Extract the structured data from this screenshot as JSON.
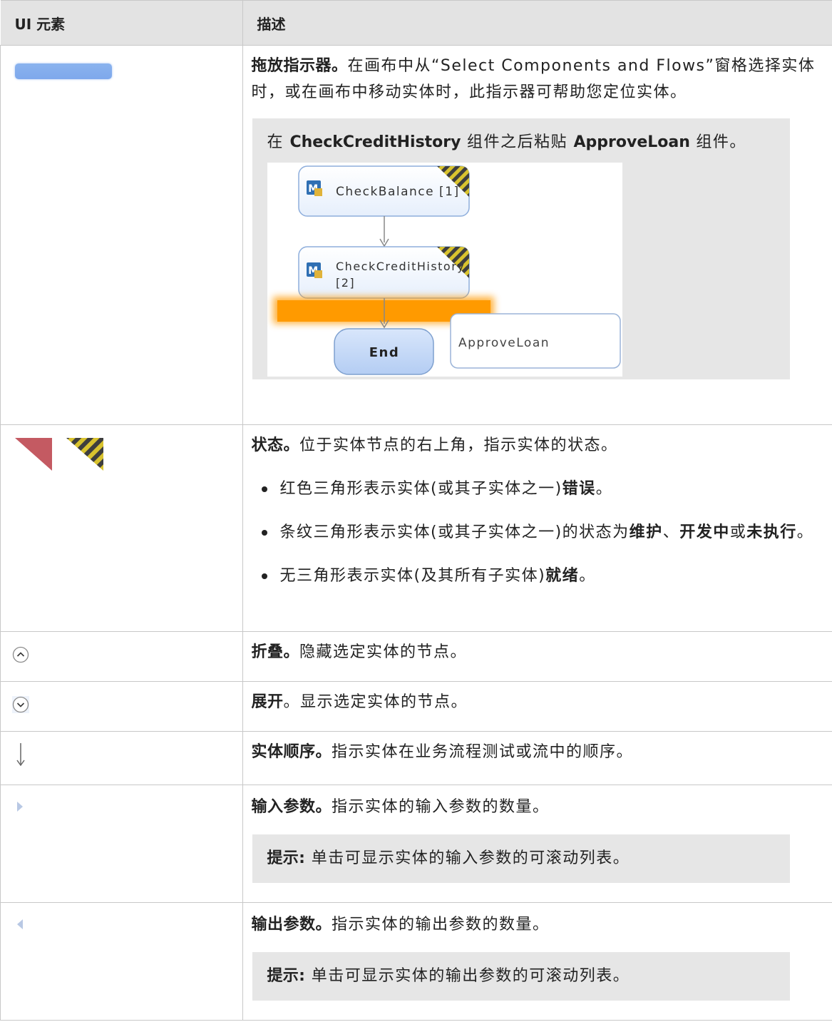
{
  "header": {
    "col1": "UI 元素",
    "col2": "描述"
  },
  "rows": {
    "drop": {
      "title": "拖放指示器。",
      "text": "在画布中从“Select Components and Flows”窗格选择实体时，或在画布中移动实体时，此指示器可帮助您定位实体。",
      "note": {
        "pre": "在 ",
        "comp1": "CheckCreditHistory",
        "mid": " 组件之后粘贴 ",
        "comp2": "ApproveLoan",
        "post": " 组件。"
      },
      "diagram": {
        "node1": "CheckBalance [1]",
        "node2_line1": "CheckCreditHistory",
        "node2_line2": "[2]",
        "end": "End",
        "dragged": "ApproveLoan"
      }
    },
    "status": {
      "title": "状态。",
      "text": "位于实体节点的右上角，指示实体的状态。",
      "b1": {
        "pre": "红色三角形表示实体(或其子实体之一)",
        "bold": "错误",
        "post": "。"
      },
      "b2": {
        "pre": "条纹三角形表示实体(或其子实体之一)的状态为",
        "bold1": "维护",
        "sep1": "、",
        "bold2": "开发中",
        "sep2": "或",
        "bold3": "未执行",
        "post": "。"
      },
      "b3": {
        "pre": "无三角形表示实体(及其所有子实体)",
        "bold": "就绪",
        "post": "。"
      },
      "colors": {
        "red": "#c45a62",
        "stripe_dark": "#3e3e3e",
        "stripe_light": "#d9c32e"
      }
    },
    "collapse": {
      "title": "折叠。",
      "text": "隐藏选定实体的节点。"
    },
    "expand": {
      "title": "展开",
      "text": "。显示选定实体的节点。"
    },
    "order": {
      "title": "实体顺序。",
      "text": "指示实体在业务流程测试或流中的顺序。"
    },
    "input": {
      "title": "输入参数。",
      "text": "指示实体的输入参数的数量。",
      "tip_label": "提示:",
      "tip_text": " 单击可显示实体的输入参数的可滚动列表。"
    },
    "output": {
      "title": "输出参数。",
      "text": "指示实体的输出参数的数量。",
      "tip_label": "提示:",
      "tip_text": " 单击可显示实体的输出参数的可滚动列表。"
    }
  }
}
